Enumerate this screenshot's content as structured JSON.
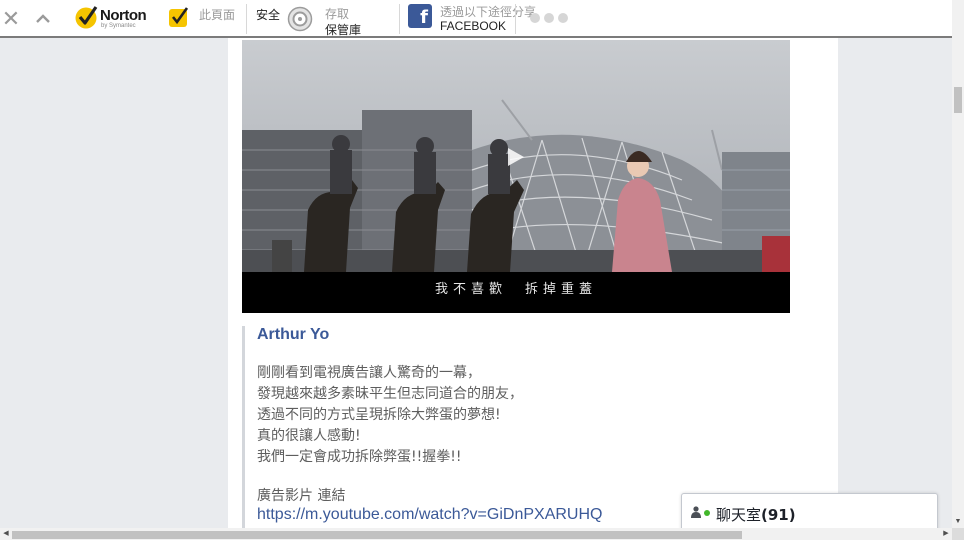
{
  "toolbar": {
    "brand": "Norton",
    "brand_sub": "by Symantec",
    "page_label": "此頁面",
    "safe_label": "安全",
    "vault_line1": "存取",
    "vault_line2": "保管庫",
    "share_line1": "透過以下途徑分享",
    "share_line2": "FACEBOOK",
    "icons": [
      "close-icon",
      "collapse-icon",
      "norton-check-icon",
      "safe-check-icon",
      "vault-icon",
      "facebook-icon"
    ],
    "colors": {
      "norton_yellow": "#f5c400",
      "facebook_blue": "#3b5998"
    }
  },
  "video": {
    "subtitle": "我不喜歡　拆掉重蓋"
  },
  "post": {
    "author": "Arthur Yo",
    "lines": [
      "剛剛看到電視廣告讓人驚奇的一幕，",
      "發現越來越多素昧平生但志同道合的朋友，",
      "透過不同的方式呈現拆除大弊蛋的夢想!",
      "真的很讓人感動!",
      "我們一定會成功拆除弊蛋!!握拳!!"
    ],
    "link_label": "廣告影片 連結",
    "link_url": "https://m.youtube.com/watch?v=GiDnPXARUHQ"
  },
  "chat": {
    "label": "聊天室",
    "count": "(91)"
  }
}
